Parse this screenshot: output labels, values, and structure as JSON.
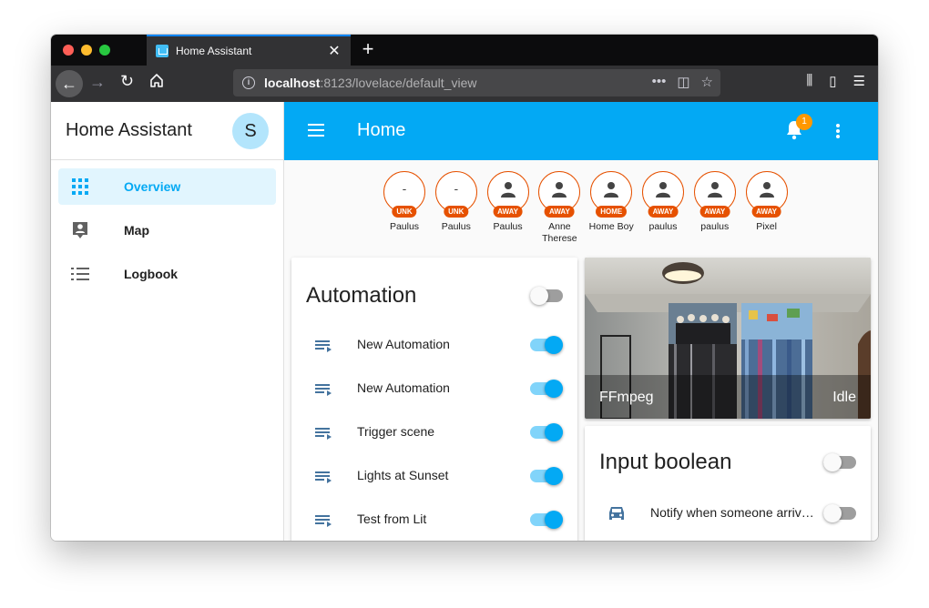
{
  "browser": {
    "tab_title": "Home Assistant",
    "tab_close": "✕",
    "new_tab": "+",
    "url_host": "localhost",
    "url_rest": ":8123/lovelace/default_view",
    "url_actions": [
      "•••",
      "◫",
      "☆"
    ]
  },
  "sidebar": {
    "title": "Home Assistant",
    "avatar_initial": "S",
    "items": [
      {
        "label": "Overview",
        "icon": "view-dashboard-icon",
        "active": true
      },
      {
        "label": "Map",
        "icon": "account-box-icon",
        "active": false
      },
      {
        "label": "Logbook",
        "icon": "format-list-bulleted-icon",
        "active": false
      }
    ]
  },
  "appbar": {
    "title": "Home",
    "notification_count": "1",
    "accent": "#03a9f4"
  },
  "person_badges": [
    {
      "name": "Paulus",
      "state": "UNK",
      "icon": "dash"
    },
    {
      "name": "Paulus",
      "state": "UNK",
      "icon": "dash"
    },
    {
      "name": "Paulus",
      "state": "AWAY",
      "icon": "person-icon"
    },
    {
      "name": "Anne Therese",
      "state": "AWAY",
      "icon": "person-icon"
    },
    {
      "name": "Home Boy",
      "state": "HOME",
      "icon": "person-icon"
    },
    {
      "name": "paulus",
      "state": "AWAY",
      "icon": "person-icon"
    },
    {
      "name": "paulus",
      "state": "AWAY",
      "icon": "person-icon"
    },
    {
      "name": "Pixel",
      "state": "AWAY",
      "icon": "person-icon"
    }
  ],
  "automation_card": {
    "title": "Automation",
    "header_toggle": "off",
    "entities": [
      {
        "name": "New Automation",
        "state": "on",
        "icon": "playlist-play-icon"
      },
      {
        "name": "New Automation",
        "state": "on",
        "icon": "playlist-play-icon"
      },
      {
        "name": "Trigger scene",
        "state": "on",
        "icon": "playlist-play-icon"
      },
      {
        "name": "Lights at Sunset",
        "state": "on",
        "icon": "playlist-play-icon"
      },
      {
        "name": "Test from Lit",
        "state": "on",
        "icon": "playlist-play-icon"
      }
    ]
  },
  "camera_card": {
    "name": "FFmpeg",
    "state": "Idle"
  },
  "input_boolean_card": {
    "title": "Input boolean",
    "header_toggle": "off",
    "entities": [
      {
        "name": "Notify when someone arriv…",
        "state": "off",
        "icon": "car-icon"
      }
    ]
  }
}
